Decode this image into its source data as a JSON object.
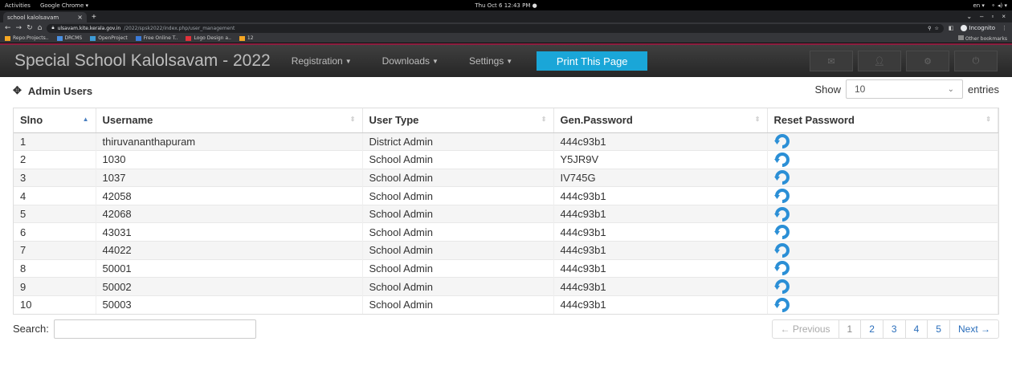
{
  "system_bar": {
    "activities": "Activities",
    "app_name": "Google Chrome ▾",
    "clock": "Thu Oct 6 12:43 PM ●",
    "lang": "en ▾"
  },
  "browser": {
    "tab_title": "school kalolsavam",
    "tab_close": "×",
    "new_tab": "+",
    "url_host": "ulsavam.kite.kerala.gov.in",
    "url_path": "/2022/spsk2022/index.php/user_management",
    "incognito": "Incognito",
    "bookmarks": [
      {
        "label": "Repo:Projects..",
        "color": "#f5a623"
      },
      {
        "label": "DRCMS",
        "color": "#4a90e2"
      },
      {
        "label": "OpenProject",
        "color": "#3d9bd6"
      },
      {
        "label": "Free Online T..",
        "color": "#3b7bd9"
      },
      {
        "label": "Logo Design a..",
        "color": "#e2323b"
      },
      {
        "label": "12",
        "color": "#f5a623"
      }
    ],
    "other_bookmarks": "Other bookmarks"
  },
  "app": {
    "brand": "Special School Kalolsavam - 2022",
    "menu": {
      "registration": "Registration",
      "downloads": "Downloads",
      "settings": "Settings"
    },
    "print_button": "Print This Page"
  },
  "panel": {
    "title": "Admin Users",
    "show_label": "Show",
    "show_value": "10",
    "entries_label": "entries"
  },
  "table": {
    "headers": {
      "slno": "Slno",
      "username": "Username",
      "user_type": "User Type",
      "gen_password": "Gen.Password",
      "reset_password": "Reset Password"
    },
    "rows": [
      {
        "slno": "1",
        "username": "thiruvananthapuram",
        "user_type": "District Admin",
        "gen_password": "444c93b1"
      },
      {
        "slno": "2",
        "username": "1030",
        "user_type": "School Admin",
        "gen_password": "Y5JR9V"
      },
      {
        "slno": "3",
        "username": "1037",
        "user_type": "School Admin",
        "gen_password": "IV745G"
      },
      {
        "slno": "4",
        "username": "42058",
        "user_type": "School Admin",
        "gen_password": "444c93b1"
      },
      {
        "slno": "5",
        "username": "42068",
        "user_type": "School Admin",
        "gen_password": "444c93b1"
      },
      {
        "slno": "6",
        "username": "43031",
        "user_type": "School Admin",
        "gen_password": "444c93b1"
      },
      {
        "slno": "7",
        "username": "44022",
        "user_type": "School Admin",
        "gen_password": "444c93b1"
      },
      {
        "slno": "8",
        "username": "50001",
        "user_type": "School Admin",
        "gen_password": "444c93b1"
      },
      {
        "slno": "9",
        "username": "50002",
        "user_type": "School Admin",
        "gen_password": "444c93b1"
      },
      {
        "slno": "10",
        "username": "50003",
        "user_type": "School Admin",
        "gen_password": "444c93b1"
      }
    ]
  },
  "footer": {
    "search_label": "Search:",
    "search_value": "",
    "pagination": {
      "previous": "← Previous",
      "pages": [
        "1",
        "2",
        "3",
        "4",
        "5"
      ],
      "current_page": "1",
      "next": "Next →"
    }
  },
  "colors": {
    "accent": "#1aa6d8",
    "navbar": "#2e2e2e",
    "navbar_accent": "#8c1d3f",
    "reset_icon": "#2b8fd6",
    "link": "#2a6ebb"
  }
}
